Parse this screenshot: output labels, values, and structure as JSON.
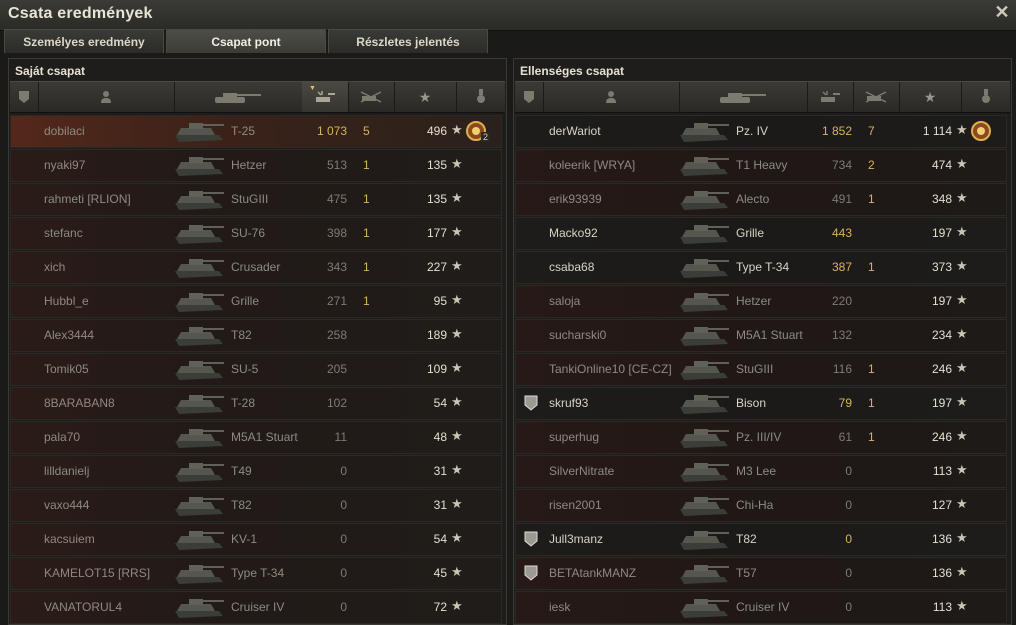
{
  "window": {
    "title": "Csata eredmények"
  },
  "tabs": [
    {
      "label": "Személyes eredmény"
    },
    {
      "label": "Csapat pont"
    },
    {
      "label": "Részletes jelentés"
    }
  ],
  "header_icons": [
    "shield-icon",
    "player-icon",
    "tank-icon",
    "damage-icon",
    "kills-icon",
    "star-icon",
    "medal-icon"
  ],
  "own_team": {
    "title": "Saját csapat",
    "rows": [
      {
        "name": "dobilaci",
        "tank": "T-25",
        "damage": "1 073",
        "kills": "5",
        "points": "496",
        "medal": "2"
      },
      {
        "name": "nyaki97",
        "tank": "Hetzer",
        "damage": "513",
        "kills": "1",
        "points": "135"
      },
      {
        "name": "rahmeti [RLION]",
        "tank": "StuGIII",
        "damage": "475",
        "kills": "1",
        "points": "135"
      },
      {
        "name": "stefanc",
        "tank": "SU-76",
        "damage": "398",
        "kills": "1",
        "points": "177"
      },
      {
        "name": "xich",
        "tank": "Crusader",
        "damage": "343",
        "kills": "1",
        "points": "227"
      },
      {
        "name": "Hubbl_e",
        "tank": "Grille",
        "damage": "271",
        "kills": "1",
        "points": "95"
      },
      {
        "name": "Alex3444",
        "tank": "T82",
        "damage": "258",
        "kills": "",
        "points": "189"
      },
      {
        "name": "Tomik05",
        "tank": "SU-5",
        "damage": "205",
        "kills": "",
        "points": "109"
      },
      {
        "name": "8BARABAN8",
        "tank": "T-28",
        "damage": "102",
        "kills": "",
        "points": "54"
      },
      {
        "name": "pala70",
        "tank": "M5A1 Stuart",
        "damage": "11",
        "kills": "",
        "points": "48"
      },
      {
        "name": "lilldanielj",
        "tank": "T49",
        "damage": "0",
        "kills": "",
        "points": "31"
      },
      {
        "name": "vaxo444",
        "tank": "T82",
        "damage": "0",
        "kills": "",
        "points": "31"
      },
      {
        "name": "kacsuiem",
        "tank": "KV-1",
        "damage": "0",
        "kills": "",
        "points": "54"
      },
      {
        "name": "KAMELOT15 [RRS]",
        "tank": "Type T-34",
        "damage": "0",
        "kills": "",
        "points": "45"
      },
      {
        "name": "VANATORUL4",
        "tank": "Cruiser IV",
        "damage": "0",
        "kills": "",
        "points": "72"
      }
    ]
  },
  "enemy_team": {
    "title": "Ellenséges csapat",
    "rows": [
      {
        "name": "derWariot",
        "tank": "Pz. IV",
        "damage": "1 852",
        "kills": "7",
        "points": "1 114",
        "alive": true,
        "medal": ""
      },
      {
        "name": "koleerik [WRYA]",
        "tank": "T1 Heavy",
        "damage": "734",
        "kills": "2",
        "points": "474",
        "alive": false
      },
      {
        "name": "erik93939",
        "tank": "Alecto",
        "damage": "491",
        "kills": "1",
        "points": "348",
        "alive": false
      },
      {
        "name": "Macko92",
        "tank": "Grille",
        "damage": "443",
        "kills": "",
        "points": "197",
        "alive": true
      },
      {
        "name": "csaba68",
        "tank": "Type T-34",
        "damage": "387",
        "kills": "1",
        "points": "373",
        "alive": true
      },
      {
        "name": "saloja",
        "tank": "Hetzer",
        "damage": "220",
        "kills": "",
        "points": "197",
        "alive": false
      },
      {
        "name": "sucharski0",
        "tank": "M5A1 Stuart",
        "damage": "132",
        "kills": "",
        "points": "234",
        "alive": false
      },
      {
        "name": "TankiOnline10 [CE-CZ]",
        "tank": "StuGIII",
        "damage": "116",
        "kills": "1",
        "points": "246",
        "alive": false
      },
      {
        "name": "skruf93",
        "tank": "Bison",
        "damage": "79",
        "kills": "1",
        "points": "197",
        "alive": true,
        "badge": true
      },
      {
        "name": "superhug",
        "tank": "Pz. III/IV",
        "damage": "61",
        "kills": "1",
        "points": "246",
        "alive": false
      },
      {
        "name": "SilverNitrate",
        "tank": "M3 Lee",
        "damage": "0",
        "kills": "",
        "points": "113",
        "alive": false
      },
      {
        "name": "risen2001",
        "tank": "Chi-Ha",
        "damage": "0",
        "kills": "",
        "points": "127",
        "alive": false
      },
      {
        "name": "Jull3manz",
        "tank": "T82",
        "damage": "0",
        "kills": "",
        "points": "136",
        "alive": true,
        "badge": true
      },
      {
        "name": "BETAtankMANZ",
        "tank": "T57",
        "damage": "0",
        "kills": "",
        "points": "136",
        "alive": false,
        "badge": true
      },
      {
        "name": "iesk",
        "tank": "Cruiser IV",
        "damage": "0",
        "kills": "",
        "points": "113",
        "alive": false
      }
    ]
  },
  "colors": {
    "accent": "#d9b45a",
    "dead_row": "#2a1b18",
    "alive_row": "#1d1c1a"
  }
}
